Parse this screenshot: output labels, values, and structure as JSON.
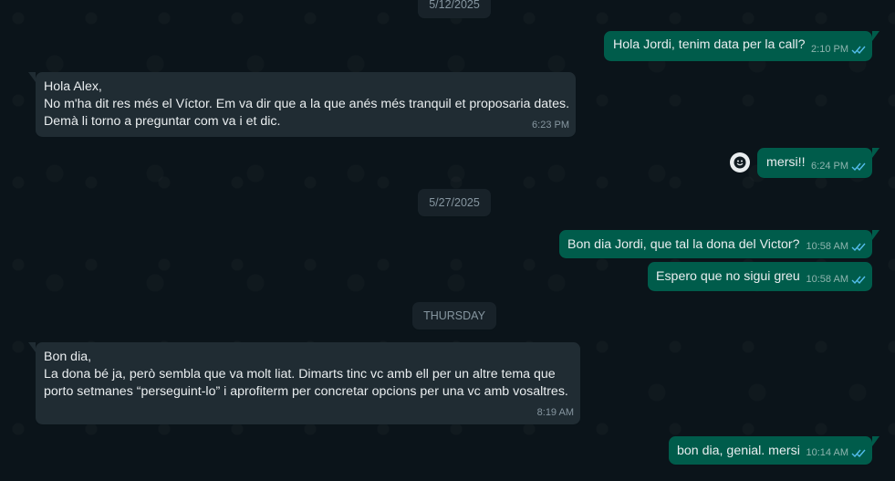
{
  "dates": {
    "d1": "5/12/2025",
    "d2": "5/27/2025",
    "d3": "THURSDAY"
  },
  "messages": [
    {
      "dir": "out",
      "text": "Hola Jordi, tenim data per la call?",
      "time": "2:10 PM"
    },
    {
      "dir": "in",
      "text": "Hola Alex,\nNo m'ha dit res més el Víctor. Em va dir que a la que anés més tranquil et proposaria dates.\nDemà li torno a preguntar com va i et dic.",
      "time": "6:23 PM"
    },
    {
      "dir": "out",
      "text": "mersi!!",
      "time": "6:24 PM"
    },
    {
      "dir": "out",
      "text": "Bon dia Jordi, que tal la dona del Victor?",
      "time": "10:58 AM"
    },
    {
      "dir": "out",
      "text": "Espero que no sigui greu",
      "time": "10:58 AM"
    },
    {
      "dir": "in",
      "text": "Bon dia,\nLa dona bé ja, però sembla que va molt liat. Dimarts tinc vc amb ell per un altre tema que\nporto setmanes “perseguint-lo” i aprofiterm per concretar opcions per una vc amb vosaltres.",
      "time": "8:19 AM"
    },
    {
      "dir": "out",
      "text": "bon dia, genial. mersi",
      "time": "10:14 AM"
    }
  ],
  "colors": {
    "outgoing": "#005c4b",
    "incoming": "#202c33",
    "read_ticks": "#53bdeb",
    "background": "#0b141a"
  },
  "icons": {
    "read_receipt": "double-check-icon",
    "reaction": "emoji-smile-icon"
  }
}
